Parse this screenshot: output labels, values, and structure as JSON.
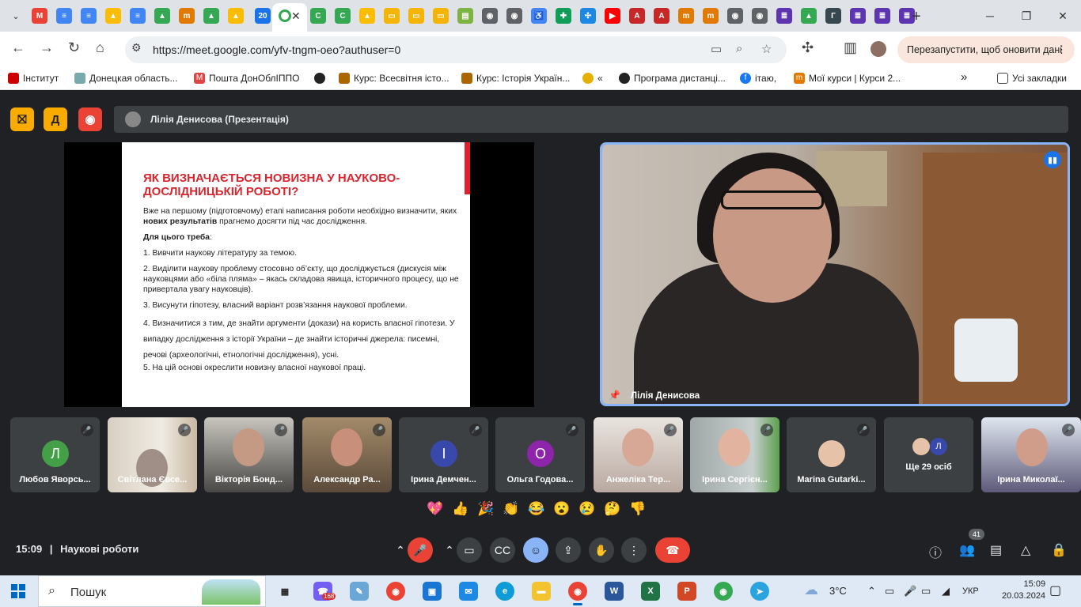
{
  "browser": {
    "active_tab_close": "✕",
    "url": "https://meet.google.com/yfv-tngm-oeo?authuser=0",
    "restart_label": "Перезапустити, щоб оновити дані",
    "bookmarks": [
      {
        "label": "Інститут",
        "icon": "flag-icon",
        "color": "#c00"
      },
      {
        "label": "Донецкая область...",
        "icon": "pawprint-icon",
        "color": "#7aa"
      },
      {
        "label": "Пошта ДонОблІППО",
        "icon": "gmail-icon",
        "color": "#d44"
      },
      {
        "label": "",
        "icon": "globe-icon",
        "color": "#222"
      },
      {
        "label": "Курс: Всесвітня істо...",
        "icon": "moodle-icon",
        "color": "#a60"
      },
      {
        "label": "Курс: Історія Україн...",
        "icon": "moodle-icon",
        "color": "#a60"
      },
      {
        "label": "«",
        "icon": "sun-icon",
        "color": "#e6b000"
      },
      {
        "label": "Програма дистанці...",
        "icon": "globe-icon",
        "color": "#222"
      },
      {
        "label": "ітаю,",
        "icon": "facebook-icon",
        "color": "#1877f2"
      },
      {
        "label": "Мої курси | Курси 2...",
        "icon": "moodle-icon",
        "color": "#e07a00"
      }
    ],
    "bookmarks_more": "»",
    "all_bookmarks": "Усі закладки"
  },
  "meet": {
    "presenter_label": "Лілія Денисова (Презентація)",
    "slide": {
      "title": "ЯК ВИЗНАЧАЄТЬСЯ НОВИЗНА У НАУКОВО-ДОСЛІДНИЦЬКІЙ РОБОТІ?",
      "intro_a": "Вже на першому (підготовчому) етапі написання роботи необхідно визначити, яких ",
      "intro_bold": "нових результатів",
      "intro_b": " прагнемо досягти під час дослідження.",
      "need": "Для цього треба",
      "need_colon": ":",
      "items": [
        "1. Вивчити наукову літературу за темою.",
        "2. Виділити наукову проблему стосовно об’єкту, що досліджується (дискусія між науковцями або «біла пляма» – якась складова явища, історичного процесу, що не привертала увагу науковців).",
        "3. Висунути гіпотезу, власний варіант розв’язання наукової проблеми.",
        "4. Визначитися з тим, де знайти аргументи (докази) на користь власної гіпотези. У випадку дослідження з історії України – де знайти історичні джерела: писемні, речові (археологічні, етнологічні дослідження), усні.",
        "5. На цій основі окреслити новизну власної наукової праці."
      ]
    },
    "speaker_name": "Лілія Денисова",
    "participants": [
      {
        "name": "Любов Яворсь...",
        "initial": "Л",
        "color": "#43a047"
      },
      {
        "name": "Світлана Євсе...",
        "initial": "",
        "color": ""
      },
      {
        "name": "Вікторія Бонд...",
        "initial": "",
        "color": ""
      },
      {
        "name": "Александр Ра...",
        "initial": "",
        "color": ""
      },
      {
        "name": "Ірина Демчен...",
        "initial": "І",
        "color": "#3949ab"
      },
      {
        "name": "Ольга Годова...",
        "initial": "О",
        "color": "#8e24aa"
      },
      {
        "name": "Анжеліка Тер...",
        "initial": "",
        "color": ""
      },
      {
        "name": "Ірина Сергієн...",
        "initial": "",
        "color": ""
      },
      {
        "name": "Marina Gutarki...",
        "initial": "",
        "color": ""
      },
      {
        "name": "Ще 29 осіб",
        "initial": "Л",
        "color": "#3949ab"
      },
      {
        "name": "Ірина Миколаї...",
        "initial": "",
        "color": ""
      }
    ],
    "reactions": [
      "💖",
      "👍",
      "🎉",
      "👏",
      "😂",
      "😮",
      "😢",
      "🤔",
      "👎"
    ],
    "time": "15:09",
    "separator": "|",
    "meeting_title": "Наукові роботи",
    "people_count": "41"
  },
  "taskbar": {
    "search_label": "Пошук",
    "viber_badge": "168",
    "weather": "3°C",
    "language": "УКР",
    "clock_time": "15:09",
    "clock_date": "20.03.2024"
  }
}
